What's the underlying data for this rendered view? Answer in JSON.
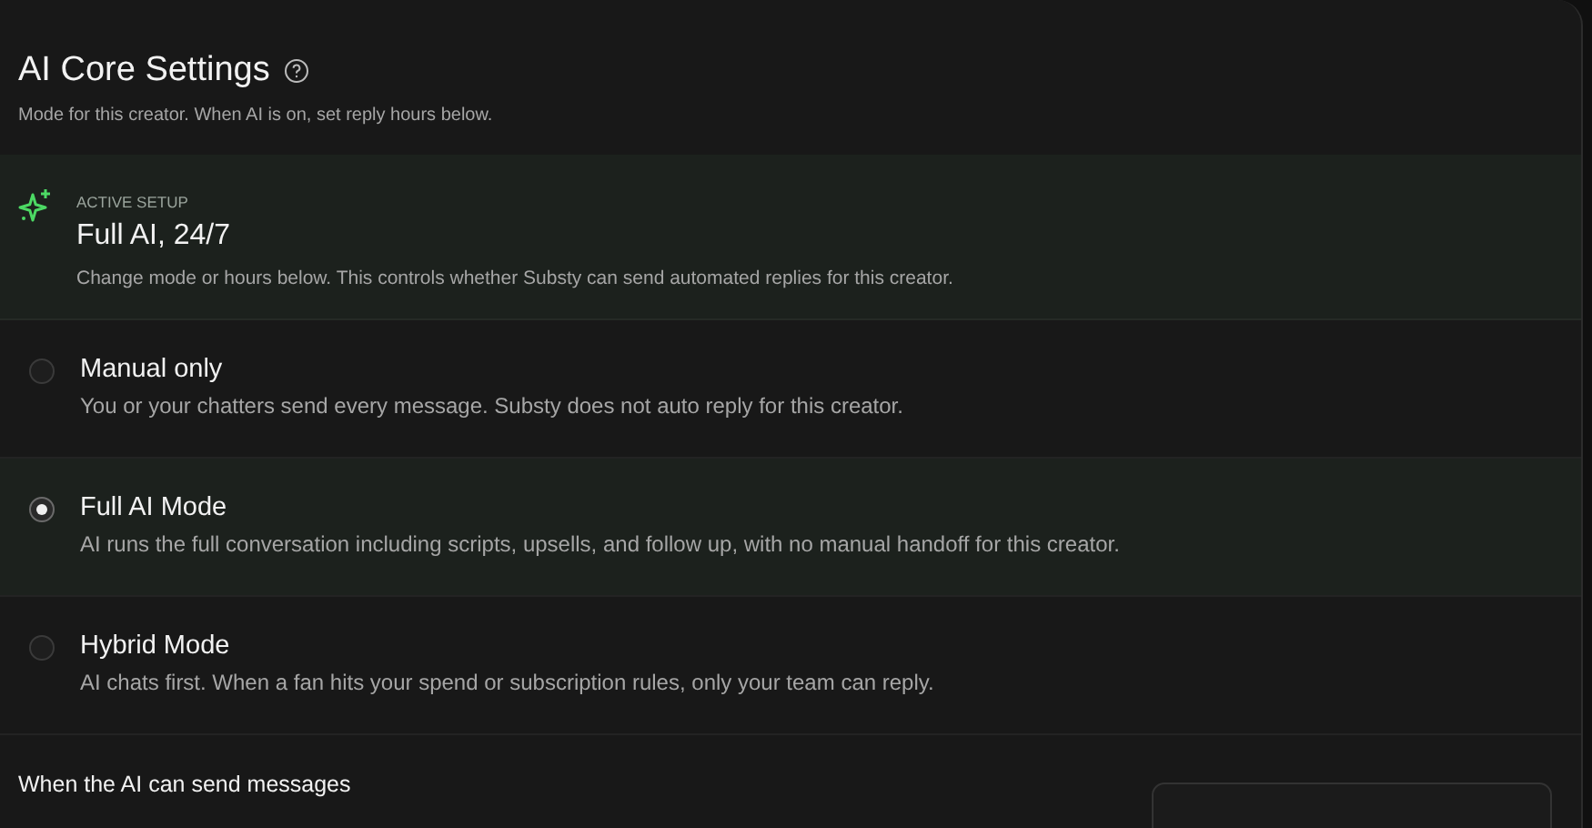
{
  "header": {
    "title": "AI Core Settings",
    "subtitle": "Mode for this creator. When AI is on, set reply hours below."
  },
  "active_setup": {
    "eyebrow": "ACTIVE SETUP",
    "title": "Full AI, 24/7",
    "description": "Change mode or hours below. This controls whether Substy can send automated replies for this creator."
  },
  "modes": [
    {
      "label": "Manual only",
      "description": "You or your chatters send every message. Substy does not auto reply for this creator.",
      "selected": false
    },
    {
      "label": "Full AI Mode",
      "description": "AI runs the full conversation including scripts, upsells, and follow up, with no manual handoff for this creator.",
      "selected": true
    },
    {
      "label": "Hybrid Mode",
      "description": "AI chats first. When a fan hits your spend or subscription rules, only your team can reply.",
      "selected": false
    }
  ],
  "schedule": {
    "label": "When the AI can send messages"
  }
}
